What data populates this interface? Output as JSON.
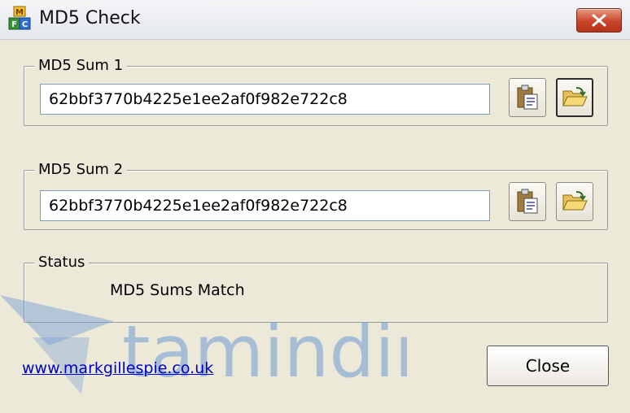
{
  "window": {
    "title": "MD5 Check",
    "app_icon": "md5-app-icon",
    "close_icon": "close-icon"
  },
  "sum1": {
    "legend": "MD5 Sum 1",
    "value": "62bbf3770b4225e1ee2af0f982e722c8",
    "paste_icon": "clipboard-paste-icon",
    "open_icon": "folder-open-icon"
  },
  "sum2": {
    "legend": "MD5 Sum 2",
    "value": "62bbf3770b4225e1ee2af0f982e722c8",
    "paste_icon": "clipboard-paste-icon",
    "open_icon": "folder-open-icon"
  },
  "status": {
    "legend": "Status",
    "text": "MD5 Sums Match"
  },
  "footer": {
    "link": "www.markgillespie.co.uk",
    "close_label": "Close"
  },
  "watermark": {
    "text": "tamindir"
  },
  "colors": {
    "window_bg": "#ece9d8",
    "close_red": "#c9442a",
    "link_blue": "#0000cc",
    "watermark_blue": "#6f9ad6"
  }
}
